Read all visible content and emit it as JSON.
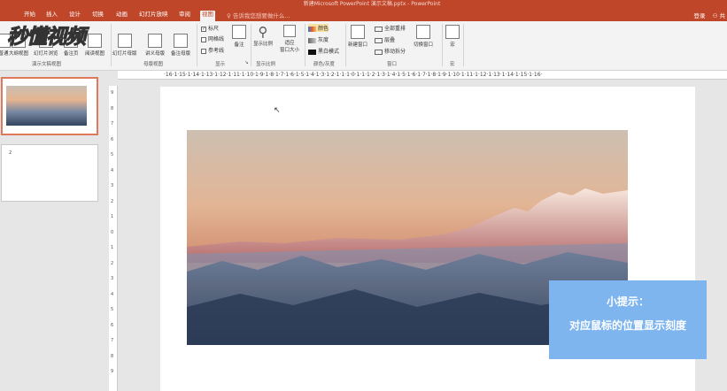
{
  "app": {
    "window_title": "新建Microsoft PowerPoint 演示文稿.pptx - PowerPoint"
  },
  "tabs": [
    {
      "label": "开始",
      "active": false
    },
    {
      "label": "插入",
      "active": false
    },
    {
      "label": "设计",
      "active": false
    },
    {
      "label": "切换",
      "active": false
    },
    {
      "label": "动画",
      "active": false
    },
    {
      "label": "幻灯片放映",
      "active": false
    },
    {
      "label": "审阅",
      "active": false
    },
    {
      "label": "视图",
      "active": true
    }
  ],
  "tell_me": "告诉我您想要做什么...",
  "account": {
    "login": "登录",
    "share": "共"
  },
  "ribbon": {
    "presentation_views": {
      "label": "演示文稿视图",
      "buttons": [
        "普通",
        "大纲视图",
        "幻灯片浏览",
        "备注页",
        "阅读视图"
      ]
    },
    "master_views": {
      "label": "母版视图",
      "buttons": [
        "幻灯片母版",
        "讲义母版",
        "备注母版"
      ]
    },
    "show": {
      "label": "显示",
      "checkboxes": [
        {
          "label": "标尺",
          "checked": true
        },
        {
          "label": "网格线",
          "checked": false
        },
        {
          "label": "参考线",
          "checked": false
        }
      ],
      "notes": "备注"
    },
    "zoom": {
      "label": "显示比例",
      "zoom_button": "显示比例",
      "fit_button_1": "适应",
      "fit_button_2": "窗口大小"
    },
    "color": {
      "label": "颜色/灰度",
      "options": [
        "颜色",
        "灰度",
        "黑白模式"
      ]
    },
    "window": {
      "label": "窗口",
      "new_window": "新建窗口",
      "arrange_all": "全部重排",
      "cascade": "层叠",
      "move_split": "移动拆分",
      "switch_windows": "切换窗口"
    },
    "macros": {
      "label": "宏",
      "button": "宏"
    }
  },
  "watermark": "秒懂视频",
  "thumbnails": [
    {
      "number": "1",
      "selected": true
    },
    {
      "number": "2",
      "selected": false
    }
  ],
  "ruler": {
    "horizontal": "·16·1·15·1·14·1·13·1·12·1·11·1·10·1·9·1·8·1·7·1·6·1·5·1·4·1·3·1·2·1·1·1·0·1·1·1·2·1·3·1·4·1·5·1·6·1·7·1·8·1·9·1·10·1·11·1·12·1·13·1·14·1·15·1·16·",
    "vertical": [
      "9",
      "8",
      "7",
      "6",
      "5",
      "4",
      "3",
      "2",
      "1",
      "0",
      "1",
      "2",
      "3",
      "4",
      "5",
      "6",
      "7",
      "8",
      "9"
    ]
  },
  "slide": {
    "tip_title": "小提示：",
    "tip_text": "对应鼠标的位置显示刻度"
  },
  "colors": {
    "accent": "#c0462a",
    "tip_bg": "#7eb5ef",
    "thumb_selected": "#e0785c"
  }
}
